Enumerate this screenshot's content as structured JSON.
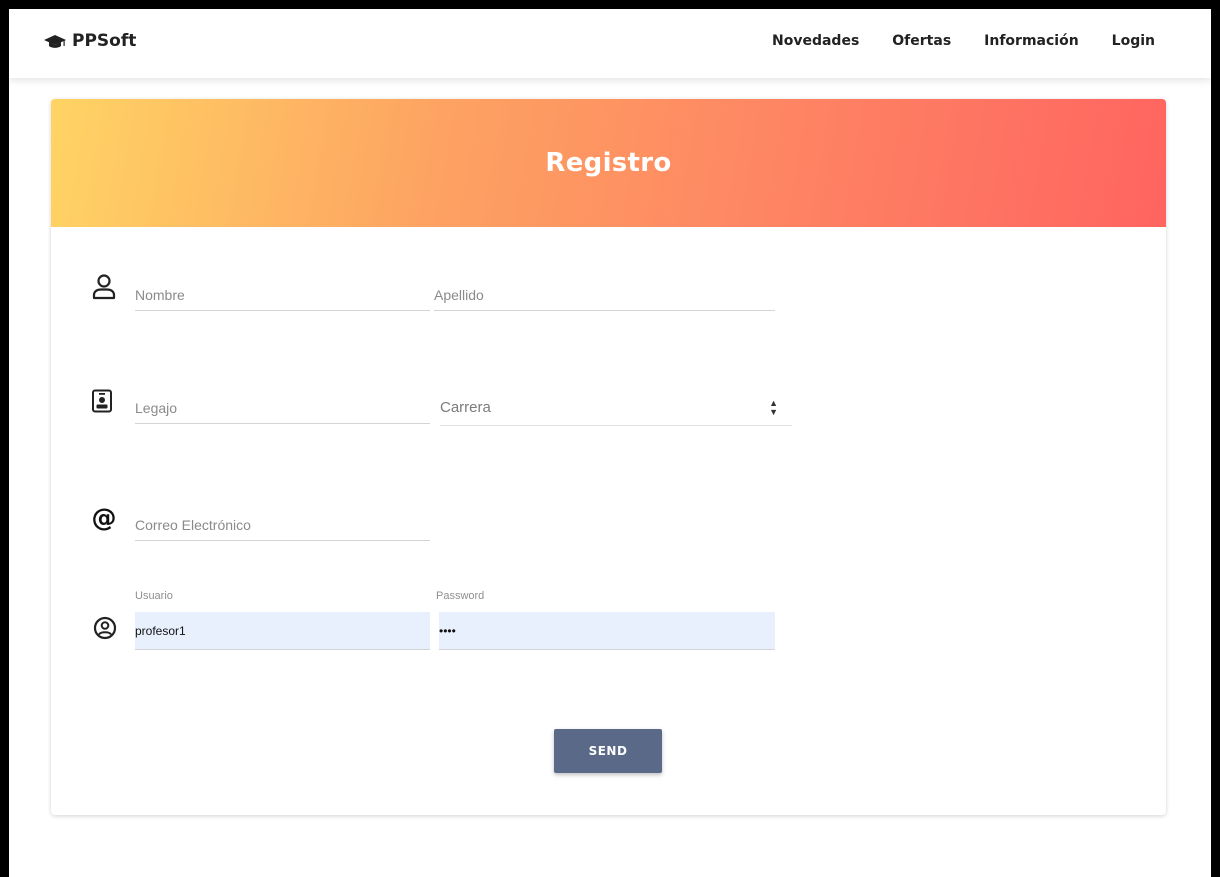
{
  "navbar": {
    "brand": "PPSoft",
    "brand_icon": "graduation-cap-icon",
    "links": [
      {
        "label": "Novedades"
      },
      {
        "label": "Ofertas"
      },
      {
        "label": "Información"
      },
      {
        "label": "Login"
      }
    ]
  },
  "form": {
    "title": "Registro",
    "fields": {
      "nombre": {
        "placeholder": "Nombre",
        "value": ""
      },
      "apellido": {
        "placeholder": "Apellido",
        "value": ""
      },
      "legajo": {
        "placeholder": "Legajo",
        "value": ""
      },
      "carrera": {
        "selected": "Carrera"
      },
      "correo": {
        "placeholder": "Correo Electrónico",
        "value": ""
      },
      "usuario": {
        "label": "Usuario",
        "value": "profesor1"
      },
      "password": {
        "label": "Password",
        "value": "••••"
      }
    },
    "send_label": "SEND"
  },
  "colors": {
    "header_gradient_start": "#ffd464",
    "header_gradient_end": "#ff6460",
    "button": "#596987",
    "autofill": "#e8f0fe"
  }
}
